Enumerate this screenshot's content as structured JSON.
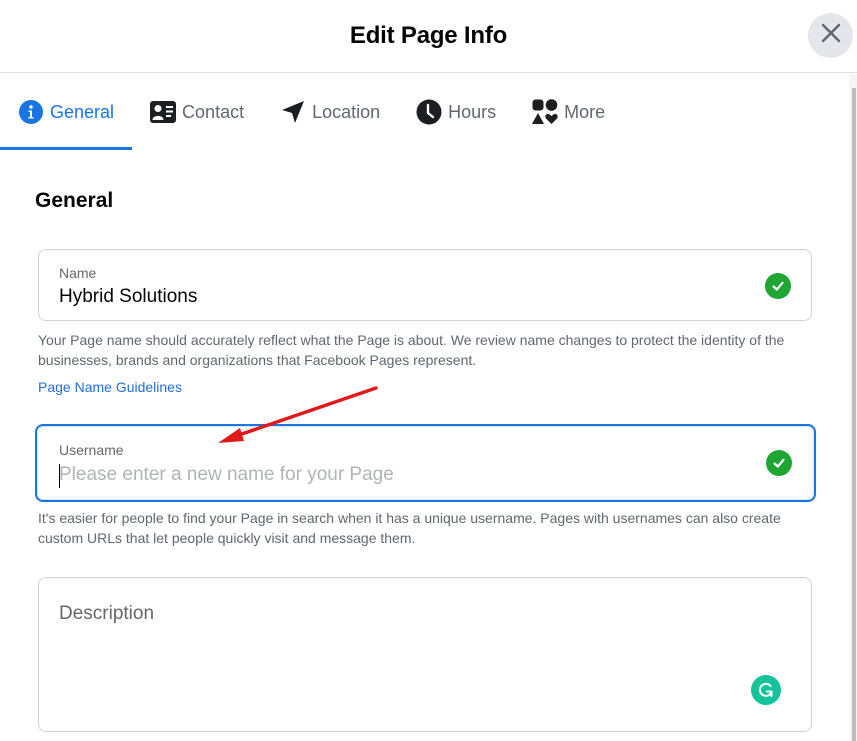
{
  "header": {
    "title": "Edit Page Info",
    "close_icon": "close-icon"
  },
  "tabs": [
    {
      "label": "General",
      "icon": "info-icon",
      "active": true
    },
    {
      "label": "Contact",
      "icon": "contact-card-icon",
      "active": false
    },
    {
      "label": "Location",
      "icon": "location-arrow-icon",
      "active": false
    },
    {
      "label": "Hours",
      "icon": "clock-icon",
      "active": false
    },
    {
      "label": "More",
      "icon": "shapes-icon",
      "active": false
    }
  ],
  "section": {
    "title": "General"
  },
  "name_field": {
    "label": "Name",
    "value": "Hybrid Solutions",
    "status_icon": "check-circle-icon",
    "help": "Your Page name should accurately reflect what the Page is about. We review name changes to protect the identity of the businesses, brands and organizations that Facebook Pages represent.",
    "link": "Page Name Guidelines"
  },
  "username_field": {
    "label": "Username",
    "value": "",
    "placeholder": "Please enter a new name for your Page",
    "status_icon": "check-circle-icon",
    "help": "It's easier for people to find your Page in search when it has a unique username. Pages with usernames can also create custom URLs that let people quickly visit and message them."
  },
  "description_field": {
    "placeholder": "Description",
    "assistant_icon": "grammarly-icon"
  },
  "colors": {
    "accent": "#1b74e4",
    "success": "#1ea532",
    "annotation": "#e0191b",
    "grammarly": "#15c39a"
  }
}
